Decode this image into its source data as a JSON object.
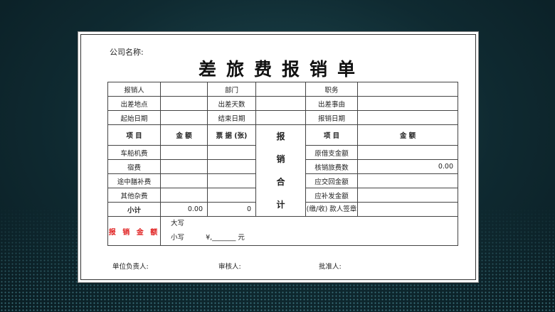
{
  "company_label": "公司名称:",
  "title": "差旅费报销单",
  "rows_info": [
    [
      "报销人",
      "部门",
      "职务"
    ],
    [
      "出差地点",
      "出差天数",
      "出差事由"
    ],
    [
      "起始日期",
      "结束日期",
      "报销日期"
    ]
  ],
  "headers": {
    "item": "项  目",
    "amount": "金  额",
    "receipts": "票 据 (张)",
    "right_item": "项  目",
    "right_amount": "金  额"
  },
  "middle_label": [
    "报",
    "销",
    "合",
    "计"
  ],
  "left_items": [
    "车船机费",
    "宿费",
    "途中膳补费",
    "其他杂费"
  ],
  "right_items": [
    "原借支金额",
    "核销旅费数",
    "应交回金额",
    "应补发金额"
  ],
  "verified_amount": "0.00",
  "subtotal": {
    "label": "小计",
    "amount": "0.00",
    "receipts": "0"
  },
  "payer_sign": "(缴/收) 款人签章",
  "total": {
    "label": "报 销 金 额",
    "upper_label": "大写",
    "lower_label": "小写",
    "lower_value": "¥,_______  元"
  },
  "footer": [
    "单位负责人:",
    "审核人:",
    "批准人:"
  ],
  "colors": {
    "background": "#0f2a31",
    "accent_red": "#e02020"
  }
}
